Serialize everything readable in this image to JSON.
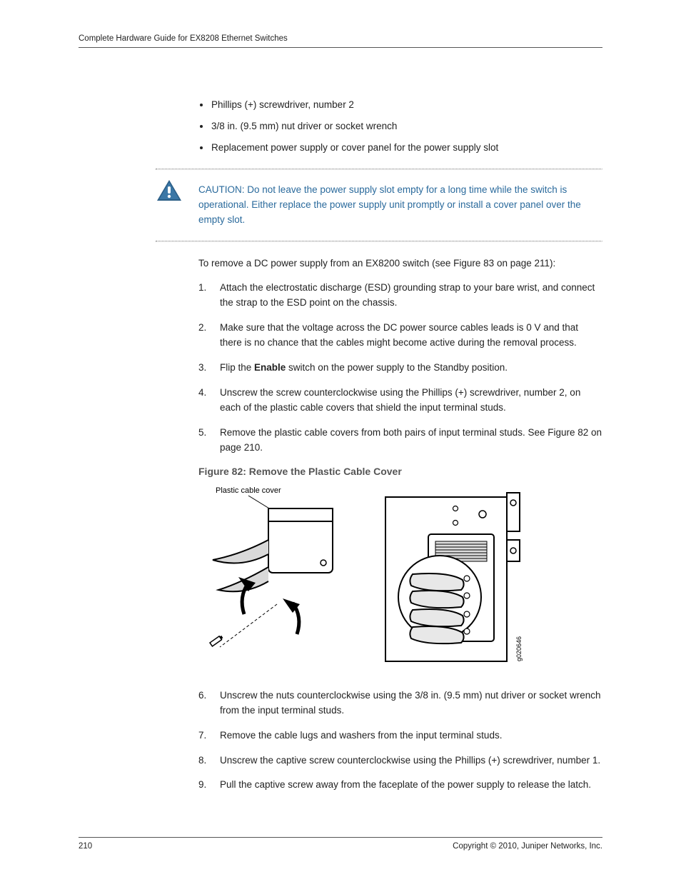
{
  "header": {
    "title": "Complete Hardware Guide for EX8208 Ethernet Switches"
  },
  "tools": [
    "Phillips (+) screwdriver, number 2",
    "3/8 in. (9.5 mm) nut driver or socket wrench",
    "Replacement power supply or cover panel for the power supply slot"
  ],
  "caution": {
    "label": "CAUTION:",
    "text": "Do not leave the power supply slot empty for a long time while the switch is operational. Either replace the power supply unit promptly or install a cover panel over the empty slot."
  },
  "intro": "To remove a DC power supply from an EX8200 switch (see Figure 83 on page 211):",
  "steps_1_5": [
    "Attach the electrostatic discharge (ESD) grounding strap to your bare wrist, and connect the strap to the ESD point on the chassis.",
    "Make sure that the voltage across the DC power source cables leads is 0 V and that there is no chance that the cables might become active during the removal process.",
    {
      "pre": "Flip the ",
      "bold": "Enable",
      "post": " switch on the power supply to the Standby position."
    },
    "Unscrew the screw counterclockwise using the Phillips (+) screwdriver, number 2, on each of the plastic cable covers that shield the input terminal studs.",
    "Remove the plastic cable covers from both pairs of input terminal studs. See Figure 82 on page 210."
  ],
  "figure": {
    "caption": "Figure 82: Remove the Plastic Cable Cover",
    "label": "Plastic cable cover",
    "code": "g020646"
  },
  "steps_6_9": [
    "Unscrew the nuts counterclockwise using the 3/8 in. (9.5 mm) nut driver or socket wrench from the input terminal studs.",
    "Remove the cable lugs and washers from the input terminal studs.",
    "Unscrew the captive screw counterclockwise using the Phillips (+) screwdriver, number 1.",
    "Pull the captive screw away from the faceplate of the power supply to release the latch."
  ],
  "footer": {
    "page": "210",
    "copyright": "Copyright © 2010, Juniper Networks, Inc."
  }
}
